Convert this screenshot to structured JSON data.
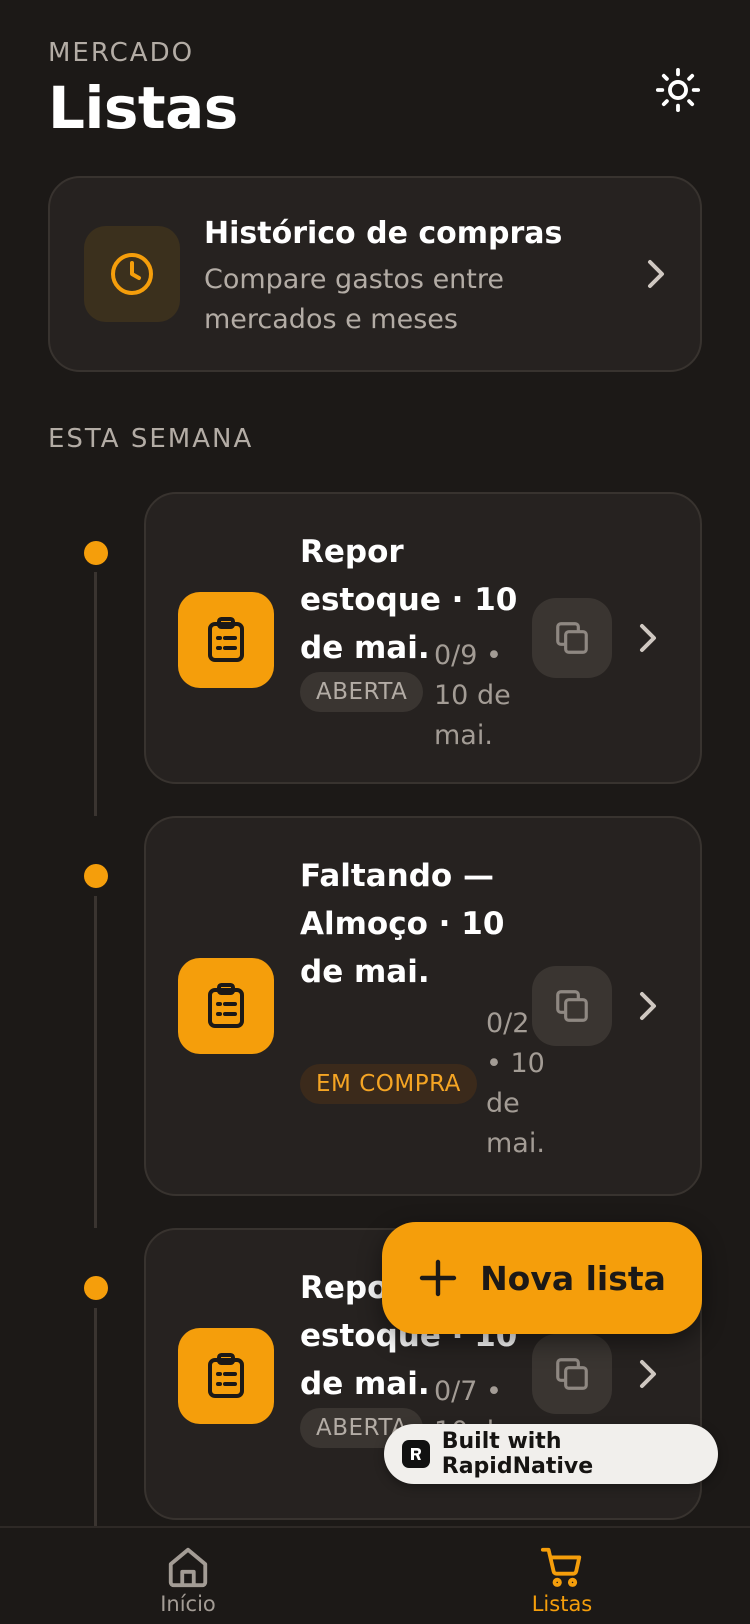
{
  "header": {
    "eyebrow": "MERCADO",
    "title": "Listas"
  },
  "history_card": {
    "title": "Histórico de compras",
    "subtitle": "Compare gastos entre mercados e meses"
  },
  "section": {
    "label": "ESTA SEMANA"
  },
  "lists": [
    {
      "title": "Repor estoque · 10 de mai.",
      "status": "ABERTA",
      "meta": "0/9 • 10 de mai."
    },
    {
      "title": "Faltando — Almoço · 10 de mai.",
      "status": "EM COMPRA",
      "meta": "0/2 • 10 de mai."
    },
    {
      "title": "Repor estoque · 10 de mai.",
      "status": "ABERTA",
      "meta": "0/7 • 10 de mai."
    }
  ],
  "fab": {
    "label": "Nova lista"
  },
  "built_badge": {
    "label": "Built with RapidNative"
  },
  "tabbar": {
    "tabs": [
      {
        "label": "Início",
        "active": false
      },
      {
        "label": "Listas",
        "active": true
      }
    ]
  },
  "colors": {
    "background": "#1c1917",
    "card": "#262220",
    "accent": "#f59e0b",
    "text_muted": "#b3aca5"
  },
  "icons": {
    "theme_toggle": "sun-icon",
    "history": "clock-icon",
    "list": "clipboard-icon",
    "duplicate": "copy-icon",
    "navigate": "chevron-right-icon",
    "fab": "plus-icon",
    "tab_home": "home-icon",
    "tab_lists": "cart-icon"
  }
}
